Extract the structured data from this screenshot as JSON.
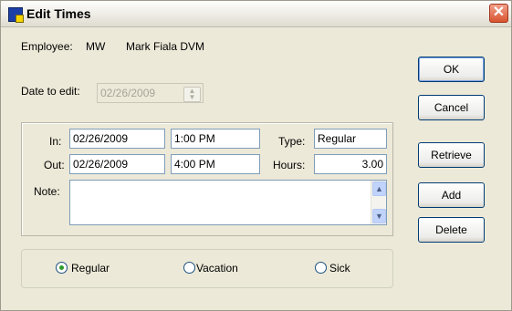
{
  "window": {
    "title": "Edit Times"
  },
  "employee": {
    "label": "Employee:",
    "code": "MW",
    "name": "Mark Fiala DVM"
  },
  "date_to_edit": {
    "label": "Date to edit:",
    "value": "02/26/2009"
  },
  "times": {
    "in_label": "In:",
    "in_date": "02/26/2009",
    "in_time": "1:00 PM",
    "type_label": "Type:",
    "type_value": "Regular",
    "out_label": "Out:",
    "out_date": "02/26/2009",
    "out_time": "4:00 PM",
    "hours_label": "Hours:",
    "hours_value": "3.00",
    "note_label": "Note:",
    "note_value": ""
  },
  "buttons": {
    "ok": "OK",
    "cancel": "Cancel",
    "retrieve": "Retrieve",
    "add": "Add",
    "delete": "Delete"
  },
  "type_radios": [
    {
      "label": "Regular",
      "checked": true
    },
    {
      "label": "Vacation",
      "checked": false
    },
    {
      "label": "Sick",
      "checked": false
    }
  ],
  "icons": {
    "app": "timeclock-icon",
    "close": "close-icon",
    "spin": "spinner-icon"
  }
}
